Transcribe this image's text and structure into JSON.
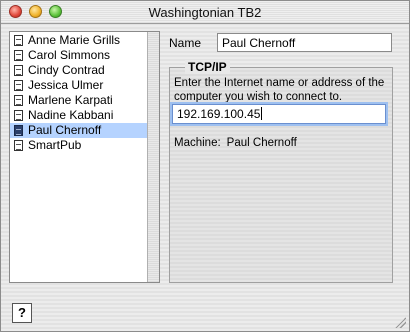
{
  "window": {
    "title": "Washingtonian TB2"
  },
  "list": {
    "items": [
      {
        "label": "Anne Marie Grills",
        "selected": false
      },
      {
        "label": "Carol Simmons",
        "selected": false
      },
      {
        "label": "Cindy Contrad",
        "selected": false
      },
      {
        "label": "Jessica Ulmer",
        "selected": false
      },
      {
        "label": "Marlene Karpati",
        "selected": false
      },
      {
        "label": "Nadine Kabbani",
        "selected": false
      },
      {
        "label": "Paul Chernoff",
        "selected": true
      },
      {
        "label": "SmartPub",
        "selected": false
      }
    ]
  },
  "details": {
    "name_label": "Name",
    "name_value": "Paul Chernoff",
    "group_title": "TCP/IP",
    "description": "Enter the Internet name or address of the computer you wish to connect to.",
    "address_value": "192.169.100.45",
    "machine_label": "Machine:",
    "machine_value": "Paul Chernoff"
  },
  "footer": {
    "help_label": "?"
  },
  "icons": {
    "close": "close-button",
    "minimize": "minimize-button",
    "zoom": "zoom-button",
    "list_item": "document-icon",
    "resize": "resize-grip-icon"
  },
  "colors": {
    "selection": "#b5d3ff",
    "focus_ring": "#9ec0f0"
  }
}
